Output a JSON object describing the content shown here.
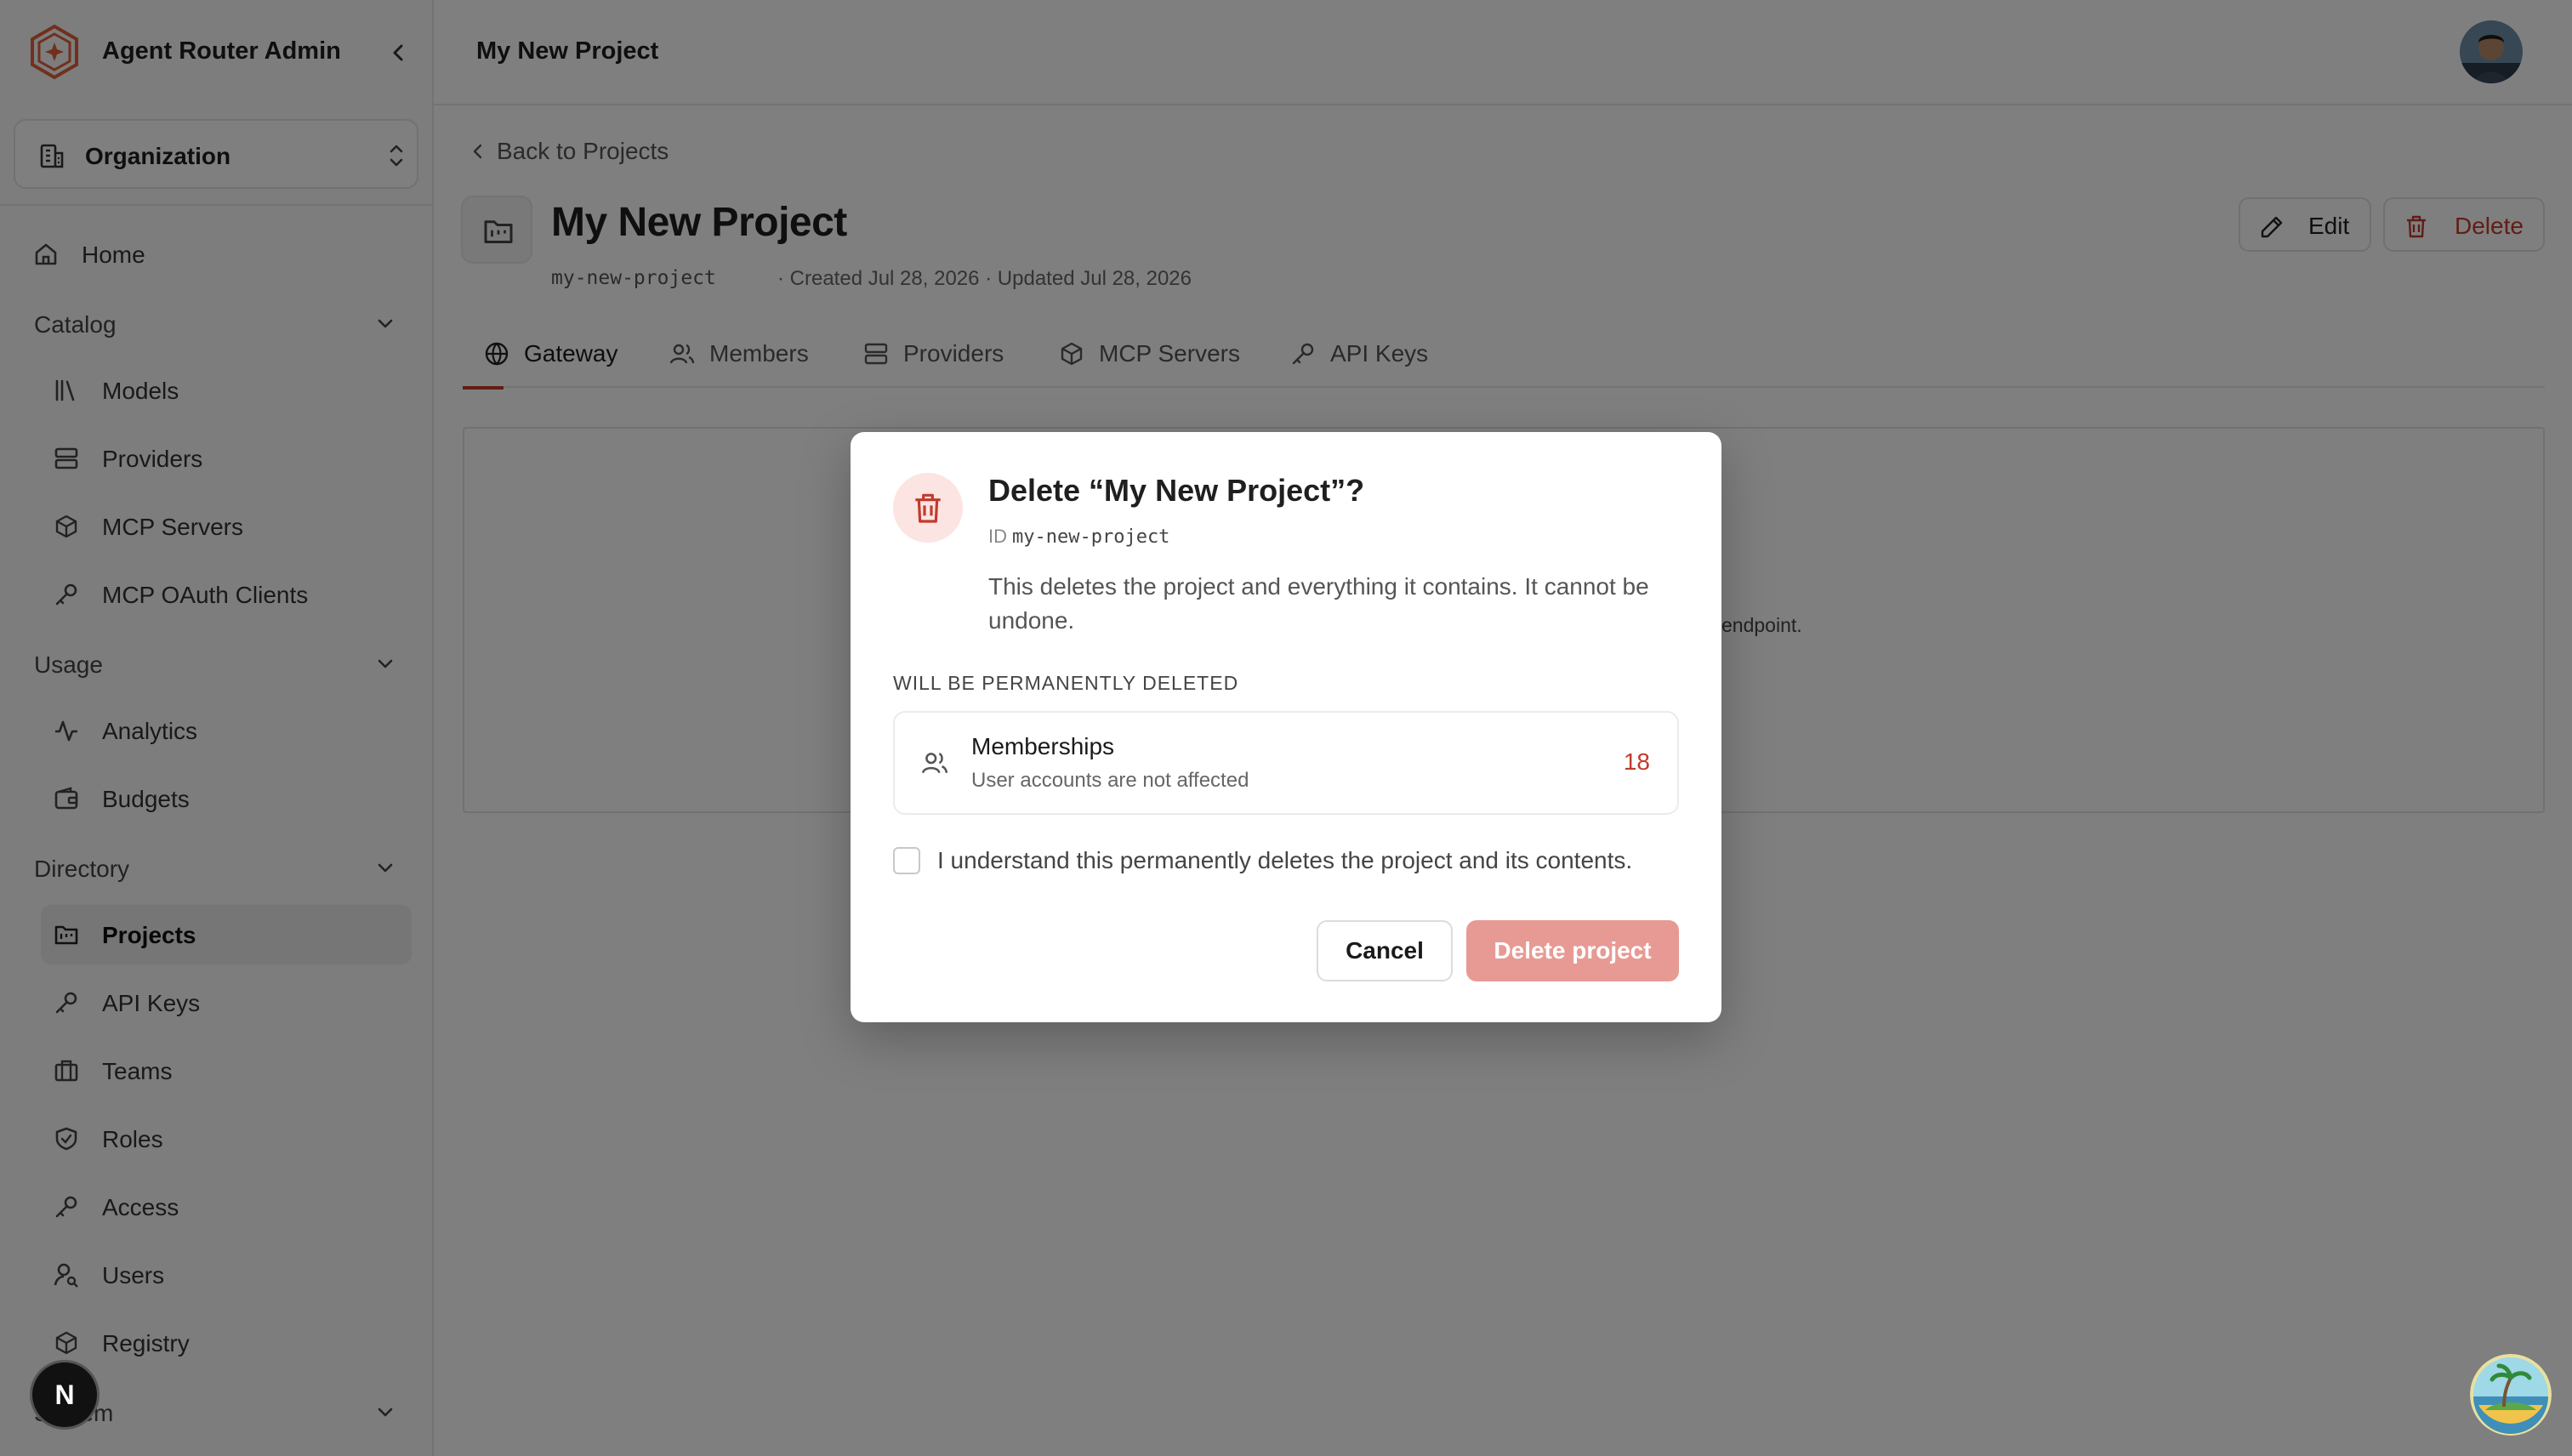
{
  "app": {
    "name": "Agent Router Admin"
  },
  "org_switcher": {
    "label": "Organization"
  },
  "nav": {
    "home": "Home",
    "catalog": {
      "label": "Catalog",
      "items": [
        "Models",
        "Providers",
        "MCP Servers",
        "MCP OAuth Clients"
      ]
    },
    "usage": {
      "label": "Usage",
      "items": [
        "Analytics",
        "Budgets"
      ]
    },
    "directory": {
      "label": "Directory",
      "items": [
        "Projects",
        "API Keys",
        "Teams",
        "Roles",
        "Access",
        "Users",
        "Registry"
      ],
      "active": "Projects"
    },
    "system": {
      "label": "System"
    }
  },
  "next_badge": "N",
  "topbar": {
    "title": "My New Project"
  },
  "page": {
    "back_label": "Back to Projects",
    "project_name": "My New Project",
    "slug": "my-new-project",
    "meta": "· Created Jul 28, 2026 · Updated Jul 28, 2026",
    "edit_label": "Edit",
    "delete_label": "Delete",
    "tabs": [
      "Gateway",
      "Members",
      "Providers",
      "MCP Servers",
      "API Keys"
    ],
    "active_tab": "Gateway",
    "gateway_hint_fragment": "endpoint."
  },
  "dialog": {
    "title": "Delete “My New Project”?",
    "id_label": "ID",
    "id_value": "my-new-project",
    "description": "This deletes the project and everything it contains. It cannot be undone.",
    "section_label": "WILL BE PERMANENTLY DELETED",
    "item": {
      "name": "Memberships",
      "note": "User accounts are not affected",
      "count": "18"
    },
    "confirm_checkbox_label": "I understand this permanently deletes the project and its contents.",
    "confirm_checked": false,
    "cancel_label": "Cancel",
    "confirm_label": "Delete project"
  },
  "colors": {
    "danger": "#c23a2c",
    "danger_disabled": "#e79a94",
    "brand": "#e0603a"
  }
}
